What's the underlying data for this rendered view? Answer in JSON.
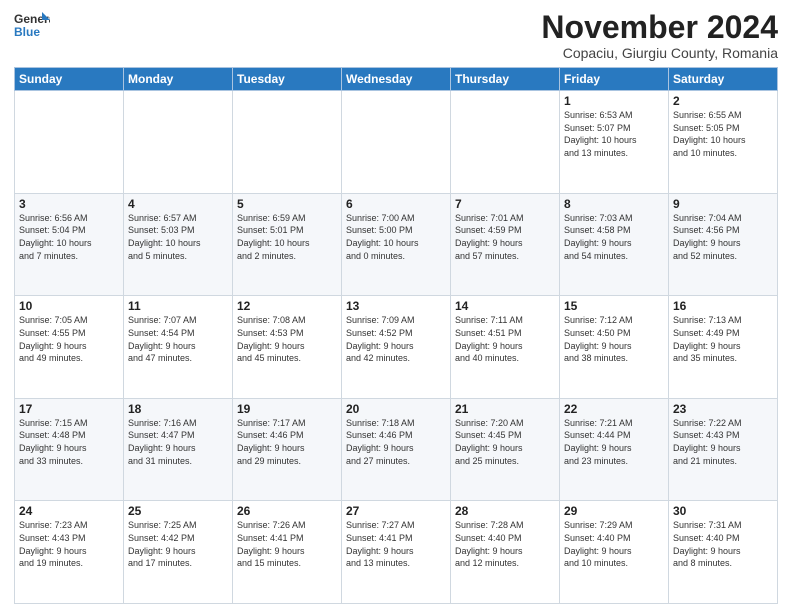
{
  "header": {
    "logo_line1": "General",
    "logo_line2": "Blue",
    "title": "November 2024",
    "subtitle": "Copaciu, Giurgiu County, Romania"
  },
  "weekdays": [
    "Sunday",
    "Monday",
    "Tuesday",
    "Wednesday",
    "Thursday",
    "Friday",
    "Saturday"
  ],
  "weeks": [
    [
      {
        "day": "",
        "info": ""
      },
      {
        "day": "",
        "info": ""
      },
      {
        "day": "",
        "info": ""
      },
      {
        "day": "",
        "info": ""
      },
      {
        "day": "",
        "info": ""
      },
      {
        "day": "1",
        "info": "Sunrise: 6:53 AM\nSunset: 5:07 PM\nDaylight: 10 hours\nand 13 minutes."
      },
      {
        "day": "2",
        "info": "Sunrise: 6:55 AM\nSunset: 5:05 PM\nDaylight: 10 hours\nand 10 minutes."
      }
    ],
    [
      {
        "day": "3",
        "info": "Sunrise: 6:56 AM\nSunset: 5:04 PM\nDaylight: 10 hours\nand 7 minutes."
      },
      {
        "day": "4",
        "info": "Sunrise: 6:57 AM\nSunset: 5:03 PM\nDaylight: 10 hours\nand 5 minutes."
      },
      {
        "day": "5",
        "info": "Sunrise: 6:59 AM\nSunset: 5:01 PM\nDaylight: 10 hours\nand 2 minutes."
      },
      {
        "day": "6",
        "info": "Sunrise: 7:00 AM\nSunset: 5:00 PM\nDaylight: 10 hours\nand 0 minutes."
      },
      {
        "day": "7",
        "info": "Sunrise: 7:01 AM\nSunset: 4:59 PM\nDaylight: 9 hours\nand 57 minutes."
      },
      {
        "day": "8",
        "info": "Sunrise: 7:03 AM\nSunset: 4:58 PM\nDaylight: 9 hours\nand 54 minutes."
      },
      {
        "day": "9",
        "info": "Sunrise: 7:04 AM\nSunset: 4:56 PM\nDaylight: 9 hours\nand 52 minutes."
      }
    ],
    [
      {
        "day": "10",
        "info": "Sunrise: 7:05 AM\nSunset: 4:55 PM\nDaylight: 9 hours\nand 49 minutes."
      },
      {
        "day": "11",
        "info": "Sunrise: 7:07 AM\nSunset: 4:54 PM\nDaylight: 9 hours\nand 47 minutes."
      },
      {
        "day": "12",
        "info": "Sunrise: 7:08 AM\nSunset: 4:53 PM\nDaylight: 9 hours\nand 45 minutes."
      },
      {
        "day": "13",
        "info": "Sunrise: 7:09 AM\nSunset: 4:52 PM\nDaylight: 9 hours\nand 42 minutes."
      },
      {
        "day": "14",
        "info": "Sunrise: 7:11 AM\nSunset: 4:51 PM\nDaylight: 9 hours\nand 40 minutes."
      },
      {
        "day": "15",
        "info": "Sunrise: 7:12 AM\nSunset: 4:50 PM\nDaylight: 9 hours\nand 38 minutes."
      },
      {
        "day": "16",
        "info": "Sunrise: 7:13 AM\nSunset: 4:49 PM\nDaylight: 9 hours\nand 35 minutes."
      }
    ],
    [
      {
        "day": "17",
        "info": "Sunrise: 7:15 AM\nSunset: 4:48 PM\nDaylight: 9 hours\nand 33 minutes."
      },
      {
        "day": "18",
        "info": "Sunrise: 7:16 AM\nSunset: 4:47 PM\nDaylight: 9 hours\nand 31 minutes."
      },
      {
        "day": "19",
        "info": "Sunrise: 7:17 AM\nSunset: 4:46 PM\nDaylight: 9 hours\nand 29 minutes."
      },
      {
        "day": "20",
        "info": "Sunrise: 7:18 AM\nSunset: 4:46 PM\nDaylight: 9 hours\nand 27 minutes."
      },
      {
        "day": "21",
        "info": "Sunrise: 7:20 AM\nSunset: 4:45 PM\nDaylight: 9 hours\nand 25 minutes."
      },
      {
        "day": "22",
        "info": "Sunrise: 7:21 AM\nSunset: 4:44 PM\nDaylight: 9 hours\nand 23 minutes."
      },
      {
        "day": "23",
        "info": "Sunrise: 7:22 AM\nSunset: 4:43 PM\nDaylight: 9 hours\nand 21 minutes."
      }
    ],
    [
      {
        "day": "24",
        "info": "Sunrise: 7:23 AM\nSunset: 4:43 PM\nDaylight: 9 hours\nand 19 minutes."
      },
      {
        "day": "25",
        "info": "Sunrise: 7:25 AM\nSunset: 4:42 PM\nDaylight: 9 hours\nand 17 minutes."
      },
      {
        "day": "26",
        "info": "Sunrise: 7:26 AM\nSunset: 4:41 PM\nDaylight: 9 hours\nand 15 minutes."
      },
      {
        "day": "27",
        "info": "Sunrise: 7:27 AM\nSunset: 4:41 PM\nDaylight: 9 hours\nand 13 minutes."
      },
      {
        "day": "28",
        "info": "Sunrise: 7:28 AM\nSunset: 4:40 PM\nDaylight: 9 hours\nand 12 minutes."
      },
      {
        "day": "29",
        "info": "Sunrise: 7:29 AM\nSunset: 4:40 PM\nDaylight: 9 hours\nand 10 minutes."
      },
      {
        "day": "30",
        "info": "Sunrise: 7:31 AM\nSunset: 4:40 PM\nDaylight: 9 hours\nand 8 minutes."
      }
    ]
  ]
}
